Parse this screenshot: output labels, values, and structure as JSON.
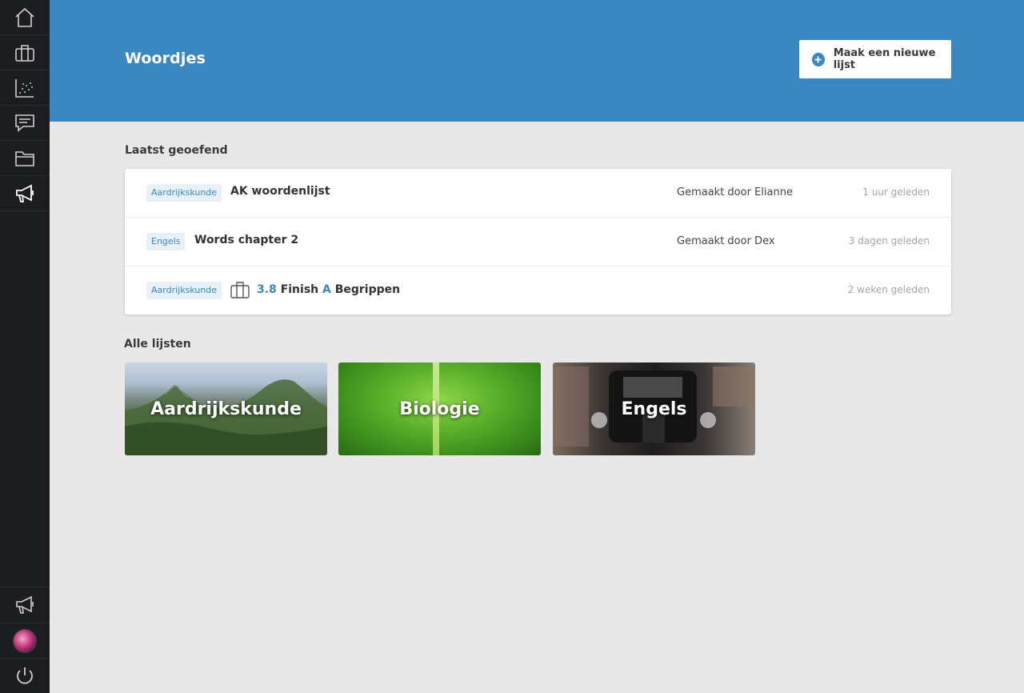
{
  "header": {
    "title": "Woordjes",
    "new_list_button": "Maak een nieuwe lijst"
  },
  "sidebar": {
    "top_items": [
      {
        "icon": "home-icon"
      },
      {
        "icon": "briefcase-icon"
      },
      {
        "icon": "chart-icon"
      },
      {
        "icon": "chat-icon"
      },
      {
        "icon": "folder-icon"
      },
      {
        "icon": "megaphone-icon",
        "active": true
      }
    ],
    "bottom_items": [
      {
        "icon": "megaphone-icon"
      },
      {
        "icon": "avatar"
      },
      {
        "icon": "power-icon"
      }
    ]
  },
  "recent": {
    "title": "Laatst geoefend",
    "rows": [
      {
        "tag": "Aardrijkskunde",
        "title": "AK woordenlijst",
        "author": "Gemaakt door Elianne",
        "time": "1 uur geleden"
      },
      {
        "tag": "Engels",
        "title": "Words chapter 2",
        "author": "Gemaakt door Dex",
        "time": "3 dagen geleden"
      },
      {
        "tag": "Aardrijkskunde",
        "title_number": "3.8",
        "title_middle": "Finish",
        "title_letter": "A",
        "title_end": "Begrippen",
        "author": "",
        "time": "2 weken geleden",
        "icon": "briefcase-icon"
      }
    ]
  },
  "all_lists": {
    "title": "Alle lijsten",
    "tiles": [
      {
        "label": "Aardrijkskunde"
      },
      {
        "label": "Biologie"
      },
      {
        "label": "Engels"
      }
    ]
  },
  "colors": {
    "header": "#3a87c2",
    "sidebar": "#1c1d21",
    "accent": "#3a87c2",
    "background": "#e8e8e8"
  }
}
